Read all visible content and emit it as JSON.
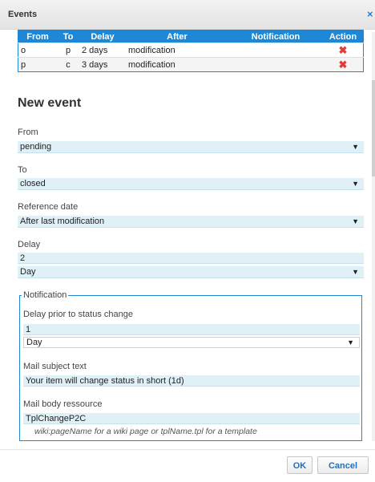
{
  "dialog": {
    "title": "Events",
    "close_glyph": "×"
  },
  "events_table": {
    "headers": [
      "From",
      "To",
      "Delay",
      "After",
      "Notification",
      "Action"
    ],
    "rows": [
      {
        "from": "o",
        "to": "p",
        "delay": "2 days",
        "after": "modification",
        "notification": "",
        "action_icon": "delete-icon"
      },
      {
        "from": "p",
        "to": "c",
        "delay": "3 days",
        "after": "modification",
        "notification": "",
        "action_icon": "delete-icon"
      }
    ]
  },
  "new_event": {
    "heading": "New event",
    "from": {
      "label": "From",
      "value": "pending"
    },
    "to": {
      "label": "To",
      "value": "closed"
    },
    "reference_date": {
      "label": "Reference date",
      "value": "After last modification"
    },
    "delay": {
      "label": "Delay",
      "amount": "2",
      "unit": "Day"
    },
    "notification": {
      "legend": "Notification",
      "delay_prior": {
        "label": "Delay prior to status change",
        "amount": "1",
        "unit": "Day"
      },
      "mail_subject": {
        "label": "Mail subject text",
        "value": "Your item will change status in short (1d)"
      },
      "mail_body": {
        "label": "Mail body ressource",
        "value": "TplChangeP2C",
        "hint": "wiki:pageName for a wiki page or tplName.tpl for a template"
      }
    }
  },
  "footer": {
    "ok_label": "OK",
    "cancel_label": "Cancel"
  },
  "colors": {
    "accent": "#1f88d6",
    "field_bg": "#dff0f7",
    "delete": "#e53935",
    "button_text": "#1f6fc2"
  }
}
